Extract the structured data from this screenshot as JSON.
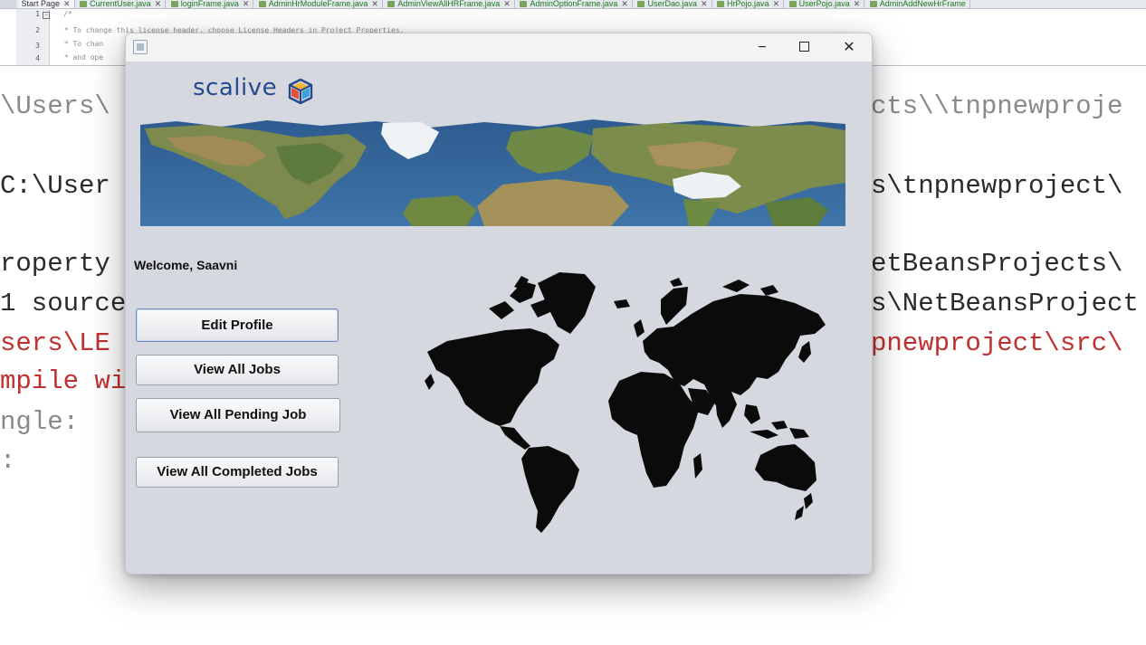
{
  "ide": {
    "tabs": [
      "Start Page",
      "CurrentUser.java",
      "loginFrame.java",
      "AdminHrModuleFrame.java",
      "AdminViewAllHRFrame.java",
      "AdminOptionFrame.java",
      "UserDao.java",
      "HrPojo.java",
      "UserPojo.java",
      "AdminAddNewHrFrame"
    ],
    "line_numbers": [
      "1",
      "2",
      "3",
      "4"
    ],
    "code_lines": [
      "/*",
      " * To change this license header, choose License Headers in Project Properties.",
      " * To chan",
      " * and ope"
    ],
    "output_left": [
      "\\Users\\",
      "C:\\User",
      "roperty",
      "1 source",
      "sers\\LE",
      "mpile wi",
      "ngle:",
      ":"
    ],
    "output_right": [
      "cts\\\\tnpnewproje",
      "s\\tnpnewproject\\",
      "etBeansProjects\\",
      "s\\NetBeansProject",
      "pnewproject\\src\\"
    ]
  },
  "window": {
    "title": "",
    "controls": {
      "minimize": "−",
      "close": "✕"
    }
  },
  "app": {
    "logo_text": "scalive",
    "welcome_label": "Welcome,",
    "user_name": "Saavni",
    "buttons": {
      "edit_profile": "Edit Profile",
      "view_all_jobs": "View All Jobs",
      "view_pending": "View All Pending Job",
      "view_completed": "View All Completed Jobs"
    }
  },
  "colors": {
    "window_bg": "#d5d8df",
    "logo_blue": "#264a8f",
    "error_red": "#c03030"
  }
}
